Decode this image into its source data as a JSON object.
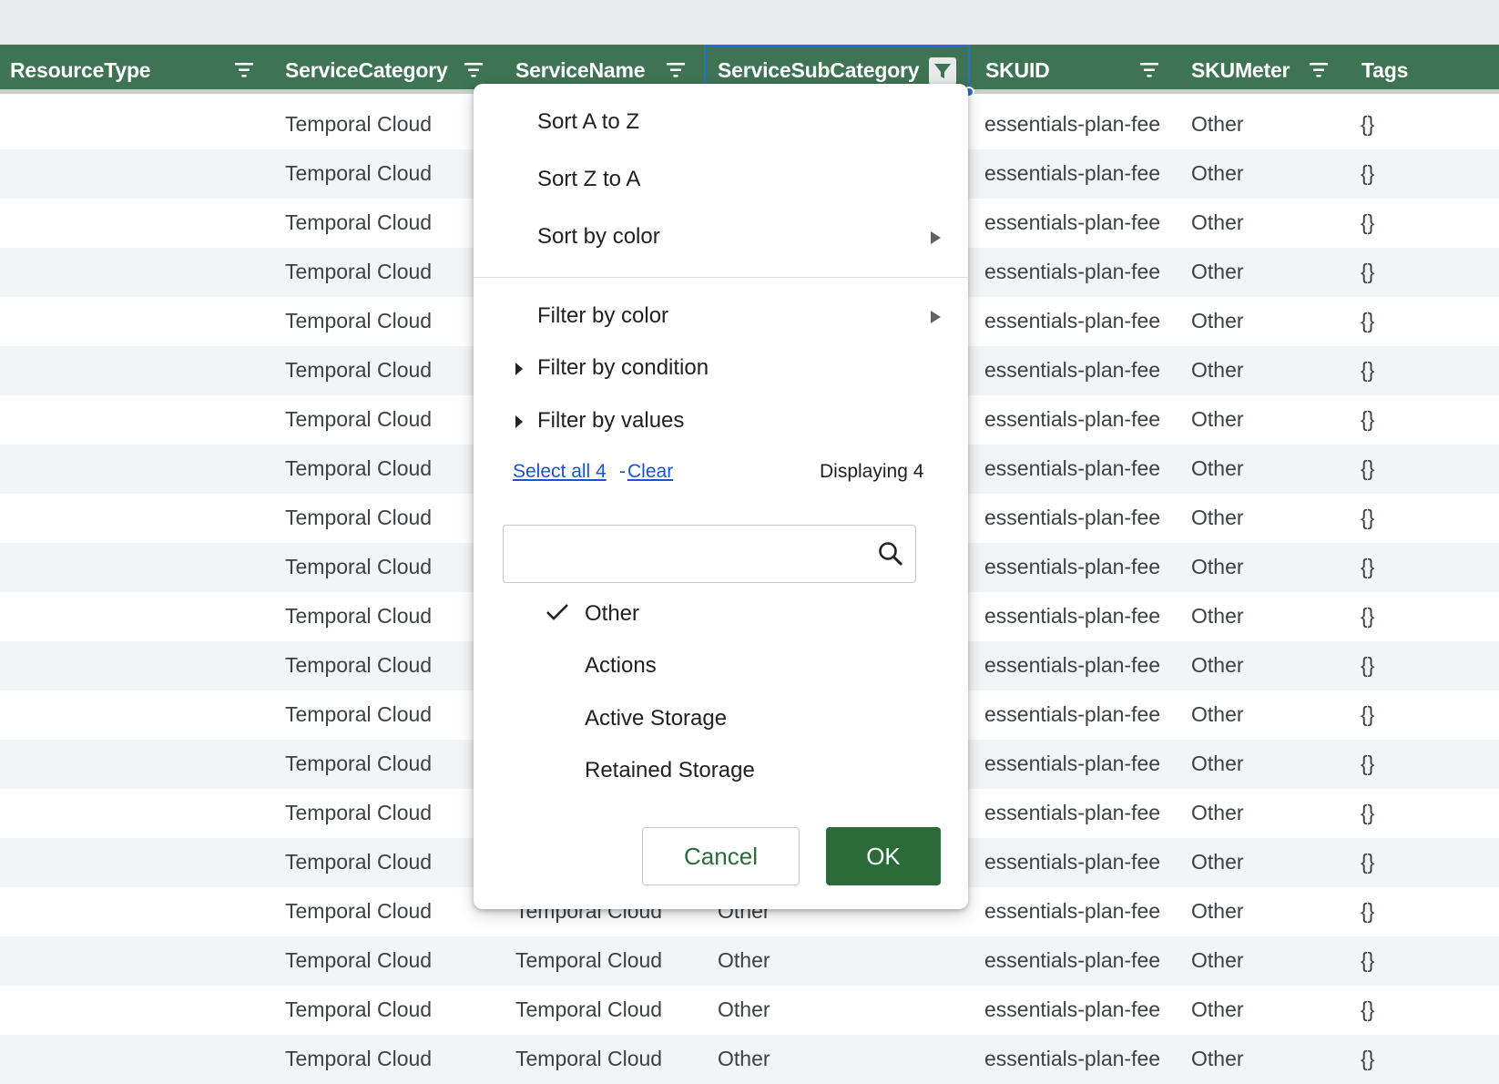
{
  "header": {
    "columns": [
      {
        "label": "ResourceType"
      },
      {
        "label": "ServiceCategory"
      },
      {
        "label": "ServiceName"
      },
      {
        "label": "ServiceSubCategory"
      },
      {
        "label": "SKUID"
      },
      {
        "label": "SKUMeter"
      },
      {
        "label": "Tags"
      }
    ]
  },
  "rows": {
    "values": [
      {
        "service_category": "Temporal Cloud",
        "service_name": "",
        "sub_category": "",
        "skuid": "essentials-plan-fee",
        "skumeter": "Other",
        "tags": "{}"
      },
      {
        "service_category": "Temporal Cloud",
        "service_name": "",
        "sub_category": "",
        "skuid": "essentials-plan-fee",
        "skumeter": "Other",
        "tags": "{}"
      },
      {
        "service_category": "Temporal Cloud",
        "service_name": "",
        "sub_category": "",
        "skuid": "essentials-plan-fee",
        "skumeter": "Other",
        "tags": "{}"
      },
      {
        "service_category": "Temporal Cloud",
        "service_name": "",
        "sub_category": "",
        "skuid": "essentials-plan-fee",
        "skumeter": "Other",
        "tags": "{}"
      },
      {
        "service_category": "Temporal Cloud",
        "service_name": "",
        "sub_category": "",
        "skuid": "essentials-plan-fee",
        "skumeter": "Other",
        "tags": "{}"
      },
      {
        "service_category": "Temporal Cloud",
        "service_name": "",
        "sub_category": "",
        "skuid": "essentials-plan-fee",
        "skumeter": "Other",
        "tags": "{}"
      },
      {
        "service_category": "Temporal Cloud",
        "service_name": "",
        "sub_category": "",
        "skuid": "essentials-plan-fee",
        "skumeter": "Other",
        "tags": "{}"
      },
      {
        "service_category": "Temporal Cloud",
        "service_name": "",
        "sub_category": "",
        "skuid": "essentials-plan-fee",
        "skumeter": "Other",
        "tags": "{}"
      },
      {
        "service_category": "Temporal Cloud",
        "service_name": "",
        "sub_category": "",
        "skuid": "essentials-plan-fee",
        "skumeter": "Other",
        "tags": "{}"
      },
      {
        "service_category": "Temporal Cloud",
        "service_name": "",
        "sub_category": "",
        "skuid": "essentials-plan-fee",
        "skumeter": "Other",
        "tags": "{}"
      },
      {
        "service_category": "Temporal Cloud",
        "service_name": "",
        "sub_category": "",
        "skuid": "essentials-plan-fee",
        "skumeter": "Other",
        "tags": "{}"
      },
      {
        "service_category": "Temporal Cloud",
        "service_name": "",
        "sub_category": "",
        "skuid": "essentials-plan-fee",
        "skumeter": "Other",
        "tags": "{}"
      },
      {
        "service_category": "Temporal Cloud",
        "service_name": "",
        "sub_category": "",
        "skuid": "essentials-plan-fee",
        "skumeter": "Other",
        "tags": "{}"
      },
      {
        "service_category": "Temporal Cloud",
        "service_name": "",
        "sub_category": "",
        "skuid": "essentials-plan-fee",
        "skumeter": "Other",
        "tags": "{}"
      },
      {
        "service_category": "Temporal Cloud",
        "service_name": "",
        "sub_category": "",
        "skuid": "essentials-plan-fee",
        "skumeter": "Other",
        "tags": "{}"
      },
      {
        "service_category": "Temporal Cloud",
        "service_name": "",
        "sub_category": "",
        "skuid": "essentials-plan-fee",
        "skumeter": "Other",
        "tags": "{}"
      },
      {
        "service_category": "Temporal Cloud",
        "service_name": "Temporal Cloud",
        "sub_category": "Other",
        "skuid": "essentials-plan-fee",
        "skumeter": "Other",
        "tags": "{}"
      },
      {
        "service_category": "Temporal Cloud",
        "service_name": "Temporal Cloud",
        "sub_category": "Other",
        "skuid": "essentials-plan-fee",
        "skumeter": "Other",
        "tags": "{}"
      },
      {
        "service_category": "Temporal Cloud",
        "service_name": "Temporal Cloud",
        "sub_category": "Other",
        "skuid": "essentials-plan-fee",
        "skumeter": "Other",
        "tags": "{}"
      },
      {
        "service_category": "Temporal Cloud",
        "service_name": "Temporal Cloud",
        "sub_category": "Other",
        "skuid": "essentials-plan-fee",
        "skumeter": "Other",
        "tags": "{}"
      }
    ]
  },
  "menu": {
    "sort_az": "Sort A to Z",
    "sort_za": "Sort Z to A",
    "sort_color": "Sort by color",
    "filter_color": "Filter by color",
    "filter_condition": "Filter by condition",
    "filter_values": "Filter by values",
    "select_all": "Select all 4",
    "separator": "-",
    "clear": "Clear",
    "displaying": "Displaying 4",
    "search_placeholder": "",
    "values": [
      {
        "label": "Other",
        "checked": true
      },
      {
        "label": "Actions",
        "checked": false
      },
      {
        "label": "Active Storage",
        "checked": false
      },
      {
        "label": "Retained Storage",
        "checked": false
      }
    ],
    "cancel": "Cancel",
    "ok": "OK"
  },
  "colors": {
    "header_bg": "#3e7453",
    "ok_button": "#2c6b39",
    "link": "#1a56c9",
    "selection": "#2a6bd6"
  }
}
